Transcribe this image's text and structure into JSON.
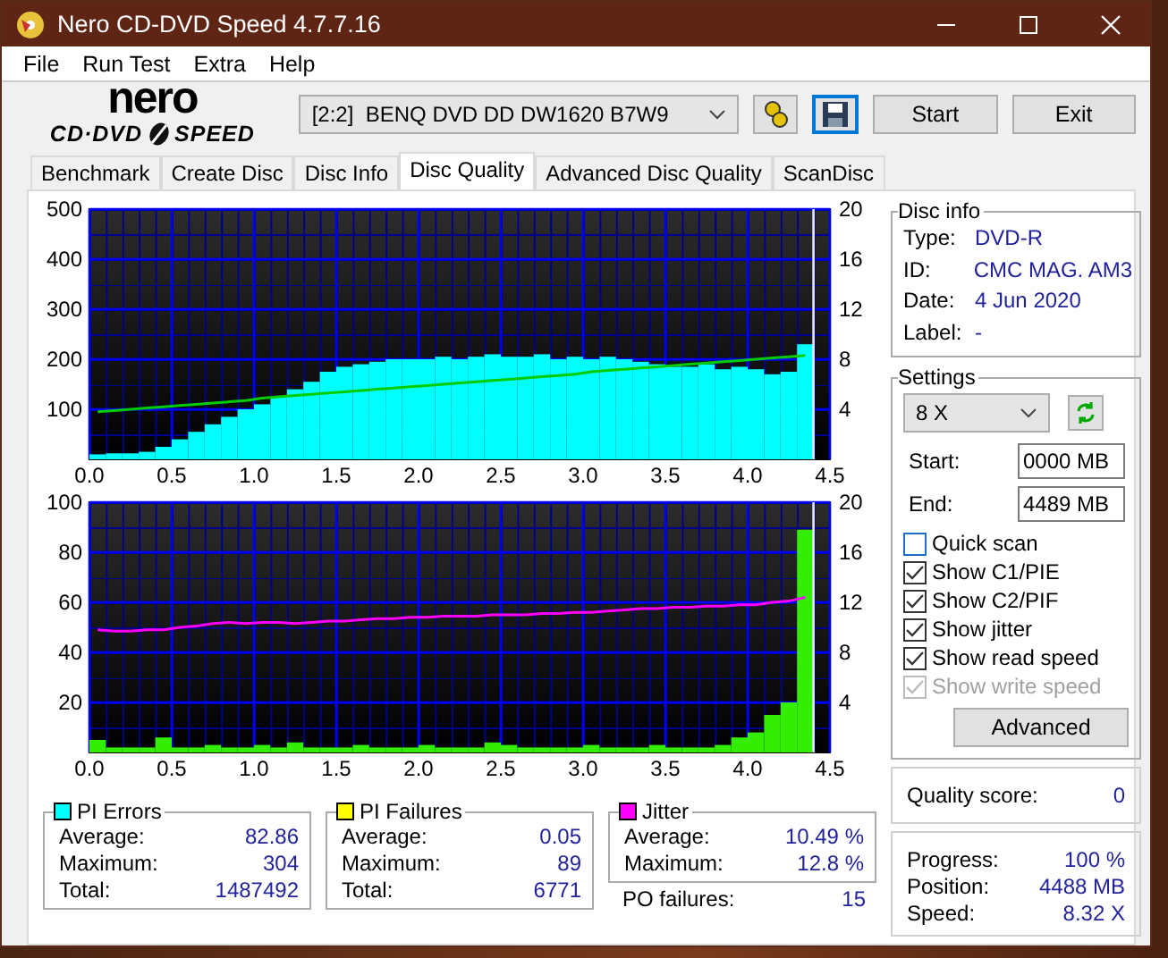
{
  "window": {
    "title": "Nero CD-DVD Speed 4.7.7.16"
  },
  "menu": [
    "File",
    "Run Test",
    "Extra",
    "Help"
  ],
  "logo": {
    "top": "nero",
    "left": "CD·DVD",
    "right": "SPEED"
  },
  "drive": {
    "value": "[2:2]  BENQ DVD DD DW1620 B7W9"
  },
  "buttons": [
    "Start",
    "Exit"
  ],
  "tabs": [
    {
      "label": "Benchmark",
      "selected": false
    },
    {
      "label": "Create Disc",
      "selected": false
    },
    {
      "label": "Disc Info",
      "selected": false
    },
    {
      "label": "Disc Quality",
      "selected": true
    },
    {
      "label": "Advanced Disc Quality",
      "selected": false
    },
    {
      "label": "ScanDisc",
      "selected": false
    }
  ],
  "charts": [
    {
      "chart_data": {
        "type": "bar",
        "grid": true,
        "ref_lines": [
          {
            "axis": "x",
            "value": 4.4,
            "color": "#e8e8ff"
          }
        ],
        "xlim": [
          0,
          4.5
        ],
        "ylim": [
          0,
          500
        ],
        "y2lim": [
          0,
          20
        ],
        "y2ticks": [
          4,
          8,
          12,
          16,
          20
        ],
        "xticks": [
          {
            "value": 0,
            "label": "0.0"
          },
          {
            "value": 0.5,
            "label": "0.5"
          },
          {
            "value": 1,
            "label": "1.0"
          },
          {
            "value": 1.5,
            "label": "1.5"
          },
          {
            "value": 2,
            "label": "2.0"
          },
          {
            "value": 2.5,
            "label": "2.5"
          },
          {
            "value": 3,
            "label": "3.0"
          },
          {
            "value": 3.5,
            "label": "3.5"
          },
          {
            "value": 4,
            "label": "4.0"
          },
          {
            "value": 4.5,
            "label": "4.5"
          }
        ],
        "yticks": [
          100,
          200,
          300,
          400,
          500
        ],
        "x": [
          0.05,
          0.15,
          0.25,
          0.35,
          0.45,
          0.55,
          0.65,
          0.75,
          0.85,
          0.95,
          1.05,
          1.15,
          1.25,
          1.35,
          1.45,
          1.55,
          1.65,
          1.75,
          1.85,
          1.95,
          2.05,
          2.15,
          2.25,
          2.35,
          2.45,
          2.55,
          2.65,
          2.75,
          2.85,
          2.95,
          3.05,
          3.15,
          3.25,
          3.35,
          3.45,
          3.55,
          3.65,
          3.75,
          3.85,
          3.95,
          4.05,
          4.15,
          4.25,
          4.35
        ],
        "series": [
          {
            "color": "#00ffff",
            "values": [
              10,
              12,
              12,
              15,
              25,
              40,
              55,
              70,
              85,
              100,
              110,
              125,
              140,
              155,
              175,
              185,
              190,
              195,
              200,
              200,
              200,
              205,
              200,
              205,
              210,
              205,
              205,
              210,
              200,
              205,
              200,
              205,
              200,
              195,
              190,
              185,
              185,
              190,
              180,
              185,
              180,
              170,
              175,
              230
            ]
          },
          {
            "type": "line",
            "axis": "y2",
            "color": "#00cc00",
            "values": [
              3.8,
              3.9,
              4.0,
              4.1,
              4.2,
              4.3,
              4.4,
              4.5,
              4.6,
              4.7,
              4.9,
              5.0,
              5.1,
              5.2,
              5.3,
              5.4,
              5.5,
              5.6,
              5.7,
              5.8,
              5.9,
              6.0,
              6.1,
              6.2,
              6.3,
              6.4,
              6.5,
              6.6,
              6.7,
              6.8,
              7.0,
              7.1,
              7.2,
              7.3,
              7.4,
              7.5,
              7.6,
              7.7,
              7.8,
              7.9,
              8.0,
              8.1,
              8.2,
              8.3
            ]
          }
        ]
      }
    },
    {
      "chart_data": {
        "type": "bar",
        "grid": true,
        "ref_lines": [
          {
            "axis": "x",
            "value": 4.4,
            "color": "#e8e8ff"
          }
        ],
        "xlim": [
          0,
          4.5
        ],
        "ylim": [
          0,
          100
        ],
        "y2lim": [
          0,
          20
        ],
        "y2ticks": [
          4,
          8,
          12,
          16,
          20
        ],
        "xticks": [
          {
            "value": 0,
            "label": "0.0"
          },
          {
            "value": 0.5,
            "label": "0.5"
          },
          {
            "value": 1,
            "label": "1.0"
          },
          {
            "value": 1.5,
            "label": "1.5"
          },
          {
            "value": 2,
            "label": "2.0"
          },
          {
            "value": 2.5,
            "label": "2.5"
          },
          {
            "value": 3,
            "label": "3.0"
          },
          {
            "value": 3.5,
            "label": "3.5"
          },
          {
            "value": 4,
            "label": "4.0"
          },
          {
            "value": 4.5,
            "label": "4.5"
          }
        ],
        "yticks": [
          20,
          40,
          60,
          80,
          100
        ],
        "x": [
          0.05,
          0.15,
          0.25,
          0.35,
          0.45,
          0.55,
          0.65,
          0.75,
          0.85,
          0.95,
          1.05,
          1.15,
          1.25,
          1.35,
          1.45,
          1.55,
          1.65,
          1.75,
          1.85,
          1.95,
          2.05,
          2.15,
          2.25,
          2.35,
          2.45,
          2.55,
          2.65,
          2.75,
          2.85,
          2.95,
          3.05,
          3.15,
          3.25,
          3.35,
          3.45,
          3.55,
          3.65,
          3.75,
          3.85,
          3.95,
          4.05,
          4.15,
          4.25,
          4.35
        ],
        "series": [
          {
            "color": "#33ee00",
            "values": [
              5,
              2,
              2,
              2,
              6,
              2,
              2,
              3,
              2,
              2,
              3,
              2,
              4,
              2,
              2,
              2,
              3,
              2,
              2,
              2,
              3,
              2,
              2,
              2,
              4,
              3,
              2,
              2,
              2,
              2,
              3,
              2,
              2,
              2,
              3,
              2,
              2,
              2,
              3,
              6,
              8,
              15,
              20,
              89
            ]
          },
          {
            "type": "line",
            "axis": "y2",
            "color": "#ff00ff",
            "values": [
              9.8,
              9.7,
              9.7,
              9.8,
              9.8,
              10.0,
              10.1,
              10.3,
              10.4,
              10.3,
              10.4,
              10.4,
              10.3,
              10.4,
              10.5,
              10.5,
              10.6,
              10.7,
              10.7,
              10.8,
              10.8,
              10.9,
              10.9,
              10.9,
              11.0,
              11.0,
              11.0,
              11.1,
              11.1,
              11.2,
              11.2,
              11.3,
              11.4,
              11.5,
              11.5,
              11.6,
              11.6,
              11.7,
              11.7,
              11.8,
              11.8,
              12.0,
              12.1,
              12.4
            ]
          }
        ]
      }
    }
  ],
  "stats": [
    {
      "title": "PI Errors",
      "color": "#00ffff",
      "rows": [
        {
          "label": "Average:",
          "value": "82.86"
        },
        {
          "label": "Maximum:",
          "value": "304"
        },
        {
          "label": "Total:",
          "value": "1487492"
        }
      ]
    },
    {
      "title": "PI Failures",
      "color": "#ffff00",
      "rows": [
        {
          "label": "Average:",
          "value": "0.05"
        },
        {
          "label": "Maximum:",
          "value": "89"
        },
        {
          "label": "Total:",
          "value": "6771"
        }
      ]
    },
    {
      "title": "Jitter",
      "color": "#ff00ff",
      "rows": [
        {
          "label": "Average:",
          "value": "10.49 %"
        },
        {
          "label": "Maximum:",
          "value": "12.8 %"
        }
      ]
    }
  ],
  "po_failures": {
    "label": "PO failures:",
    "value": "15"
  },
  "disc_info": {
    "title": "Disc info",
    "rows": [
      {
        "label": "Type:",
        "value": "DVD-R"
      },
      {
        "label": "ID:",
        "value": "CMC MAG. AM3"
      },
      {
        "label": "Date:",
        "value": "4 Jun 2020"
      },
      {
        "label": "Label:",
        "value": "-"
      }
    ]
  },
  "settings": {
    "title": "Settings",
    "speed": "8 X",
    "start_label": "Start:",
    "start": "0000 MB",
    "end_label": "End:",
    "end": "4489 MB",
    "options": [
      {
        "label": "Quick scan",
        "checked": false,
        "disabled": false
      },
      {
        "label": "Show C1/PIE",
        "checked": true,
        "disabled": false
      },
      {
        "label": "Show C2/PIF",
        "checked": true,
        "disabled": false
      },
      {
        "label": "Show jitter",
        "checked": true,
        "disabled": false
      },
      {
        "label": "Show read speed",
        "checked": true,
        "disabled": false
      },
      {
        "label": "Show write speed",
        "checked": true,
        "disabled": true
      }
    ],
    "advanced": "Advanced"
  },
  "quality": {
    "label": "Quality score:",
    "value": "0"
  },
  "progress": [
    {
      "label": "Progress:",
      "value": "100 %"
    },
    {
      "label": "Position:",
      "value": "4488 MB"
    },
    {
      "label": "Speed:",
      "value": "8.32 X"
    }
  ]
}
